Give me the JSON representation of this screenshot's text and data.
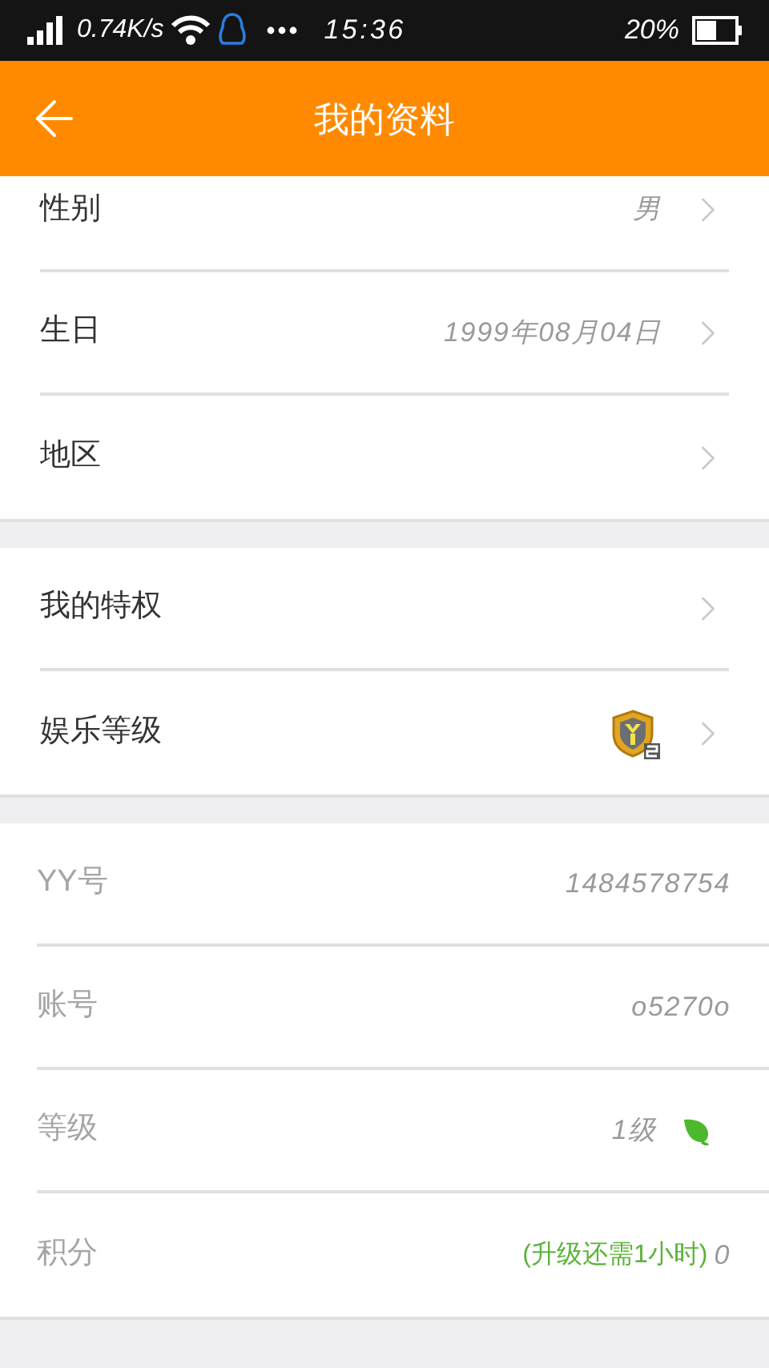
{
  "status_bar": {
    "speed": "0.74K/s",
    "time": "15:36",
    "battery": "20%"
  },
  "header": {
    "title": "我的资料"
  },
  "groups": [
    {
      "rows": [
        {
          "kind": "text",
          "label": "性别",
          "value": "男",
          "arrow": true,
          "disabled": false
        },
        {
          "kind": "text",
          "label": "生日",
          "value": "1999年08月04日",
          "arrow": true,
          "disabled": false
        },
        {
          "kind": "plain",
          "label": "地区",
          "arrow": true,
          "disabled": false
        }
      ]
    },
    {
      "rows": [
        {
          "kind": "plain",
          "label": "我的特权",
          "arrow": true,
          "disabled": false
        },
        {
          "kind": "badge",
          "label": "娱乐等级",
          "arrow": true,
          "disabled": false
        }
      ]
    },
    {
      "rows": [
        {
          "kind": "text",
          "label": "YY号",
          "value": "1484578754",
          "arrow": false,
          "disabled": true
        },
        {
          "kind": "text",
          "label": "账号",
          "value": "o5270o",
          "arrow": false,
          "disabled": true
        },
        {
          "kind": "leaf",
          "label": "等级",
          "value": "1级",
          "arrow": false,
          "disabled": true
        },
        {
          "kind": "note",
          "label": "积分",
          "note": "(升级还需1小时)",
          "value": "0",
          "arrow": false,
          "disabled": true
        }
      ]
    }
  ]
}
